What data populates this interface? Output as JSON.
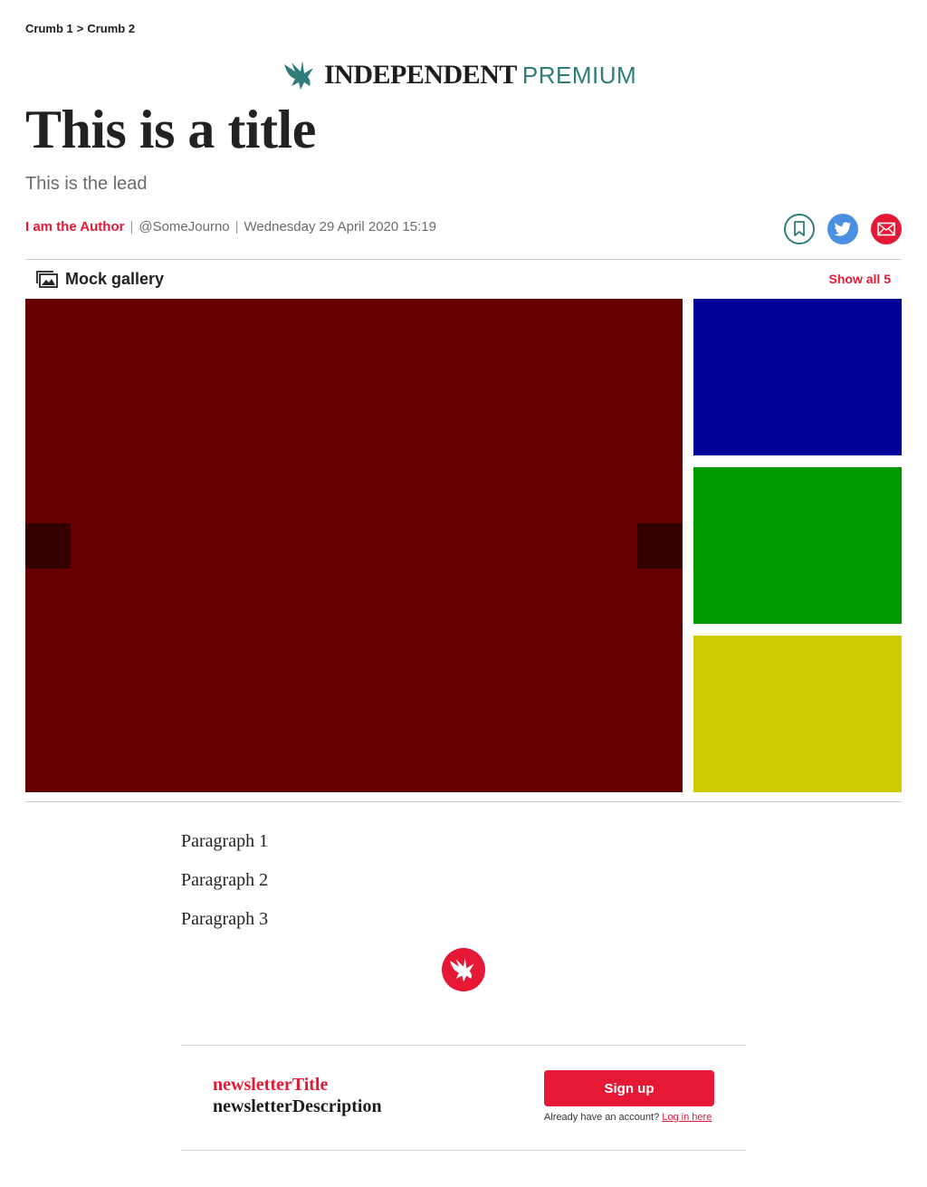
{
  "breadcrumb": {
    "crumb1": "Crumb 1",
    "separator": ">",
    "crumb2": "Crumb 2"
  },
  "masthead": {
    "brand": "INDEPENDENT",
    "premium": "PREMIUM",
    "icon": "eagle-logo-icon"
  },
  "article": {
    "title": "This is a title",
    "lead": "This is the lead",
    "author": "I am the Author",
    "twitter_handle": "@SomeJourno",
    "date": "Wednesday 29 April 2020 15:19",
    "separator": "|"
  },
  "share": {
    "bookmark_icon": "bookmark-icon",
    "twitter_icon": "twitter-icon",
    "email_icon": "email-icon"
  },
  "gallery": {
    "title": "Mock gallery",
    "show_all": "Show all 5",
    "icon": "gallery-icon",
    "main_color": "#660000",
    "nav_color": "#330000",
    "thumbs": [
      "#000099",
      "#009900",
      "#cccc00"
    ]
  },
  "body": {
    "paragraphs": [
      "Paragraph 1",
      "Paragraph 2",
      "Paragraph 3"
    ]
  },
  "newsletter": {
    "title": "newsletterTitle",
    "description": "newsletterDescription",
    "signup_label": "Sign up",
    "account_prompt": "Already have an account?",
    "login_link": "Log in here"
  },
  "colors": {
    "accent": "#e51936",
    "premium": "#2f7d7b",
    "twitter": "#4a90e2"
  }
}
